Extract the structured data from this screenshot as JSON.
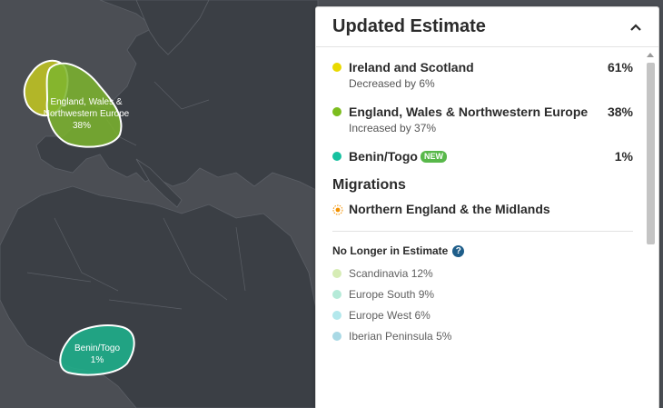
{
  "map": {
    "regions": [
      {
        "label_line1": "England, Wales &",
        "label_line2": "Northwestern Europe",
        "percent": "38%"
      },
      {
        "label_line1": "Benin/Togo",
        "label_line2": "",
        "percent": "1%"
      }
    ],
    "colors": {
      "land": "#3b3f45",
      "sea": "#4b4e54",
      "border": "#5b5f66",
      "ireland_scotland": "#d4d91a",
      "england_nw_europe": "#7db52e",
      "benin_togo": "#1fae8a"
    }
  },
  "panel": {
    "title": "Updated Estimate",
    "collapse_icon": "chevron-up-icon",
    "estimates": [
      {
        "name": "Ireland and Scotland",
        "sub": "Decreased by 6%",
        "percent": "61%",
        "color": "#e9d900"
      },
      {
        "name": "England, Wales & Northwestern Europe",
        "sub": "Increased by 37%",
        "percent": "38%",
        "color": "#7cbd1e"
      },
      {
        "name": "Benin/Togo",
        "badge": "NEW",
        "percent": "1%",
        "color": "#16c1a0"
      }
    ],
    "migrations_title": "Migrations",
    "migrations": [
      {
        "label": "Northern England & the Midlands",
        "icon": "migration-icon",
        "color": "#f29100"
      }
    ],
    "no_longer_title": "No Longer in Estimate",
    "help_icon_text": "?",
    "no_longer": [
      {
        "label": "Scandinavia 12%",
        "color": "#d6ecb5"
      },
      {
        "label": "Europe South 9%",
        "color": "#b5ead8"
      },
      {
        "label": "Europe West 6%",
        "color": "#b3e8ec"
      },
      {
        "label": "Iberian Peninsula 5%",
        "color": "#a9d9e5"
      }
    ]
  }
}
